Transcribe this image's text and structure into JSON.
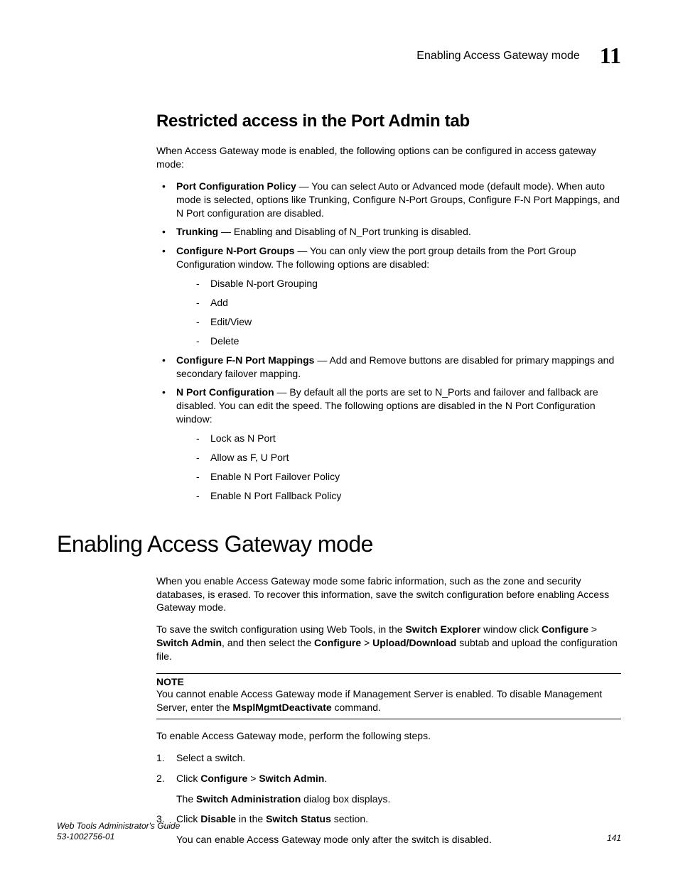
{
  "header": {
    "title": "Enabling Access Gateway mode",
    "chapter": "11"
  },
  "section1": {
    "heading": "Restricted access in the Port Admin tab",
    "intro": "When Access Gateway mode is enabled, the following options can be configured in access gateway mode:",
    "b1": {
      "term": "Port Configuration Policy",
      "rest": " — You can select Auto or Advanced mode (default mode). When auto mode is selected, options like Trunking, Configure N-Port Groups, Configure F-N Port Mappings, and N Port configuration are disabled."
    },
    "b2": {
      "term": "Trunking",
      "rest": " — Enabling and Disabling of N_Port trunking is disabled."
    },
    "b3": {
      "term": "Configure N-Port Groups",
      "rest": " — You can only view the port group details from the Port Group Configuration window. The following options are disabled:",
      "s1": "Disable N-port Grouping",
      "s2": "Add",
      "s3": "Edit/View",
      "s4": "Delete"
    },
    "b4": {
      "term": "Configure F-N Port Mappings",
      "rest": " — Add and Remove buttons are disabled for primary mappings and secondary failover mapping."
    },
    "b5": {
      "term": "N Port Configuration",
      "rest": " — By default all the ports are set to N_Ports and failover and fallback are disabled. You can edit the speed. The following options are disabled in the N Port Configuration window:",
      "s1": "Lock as N Port",
      "s2": "Allow as F, U Port",
      "s3": "Enable N Port Failover Policy",
      "s4": "Enable N Port Fallback Policy"
    }
  },
  "section2": {
    "heading": "Enabling Access Gateway mode",
    "p1": "When you enable Access Gateway mode some fabric information, such as the zone and security databases, is erased. To recover this information, save the switch configuration before enabling Access Gateway mode.",
    "p2a": "To save the switch configuration using Web Tools, in the ",
    "p2b": "Switch Explorer",
    "p2c": " window click ",
    "p2d": "Configure",
    "p2e": " > ",
    "p2f": "Switch Admin",
    "p2g": ", and then select the ",
    "p2h": "Configure",
    "p2i": " > ",
    "p2j": "Upload/Download",
    "p2k": " subtab and upload the configuration file.",
    "note": {
      "label": "NOTE",
      "t1": "You cannot enable Access Gateway mode if Management Server is enabled. To disable Management Server, enter the ",
      "cmd": "MsplMgmtDeactivate",
      "t2": " command."
    },
    "p3": "To enable Access Gateway mode, perform the following steps.",
    "steps": {
      "s1": "Select a switch.",
      "s2a": "Click ",
      "s2b": "Configure",
      "s2c": " > ",
      "s2d": "Switch Admin",
      "s2e": ".",
      "s2sub_a": "The ",
      "s2sub_b": "Switch Administration",
      "s2sub_c": " dialog box displays.",
      "s3a": "Click ",
      "s3b": "Disable",
      "s3c": " in the ",
      "s3d": "Switch Status",
      "s3e": " section.",
      "s3sub": "You can enable Access Gateway mode only after the switch is disabled."
    }
  },
  "footer": {
    "guide": "Web Tools Administrator's Guide",
    "docnum": "53-1002756-01",
    "page": "141"
  }
}
